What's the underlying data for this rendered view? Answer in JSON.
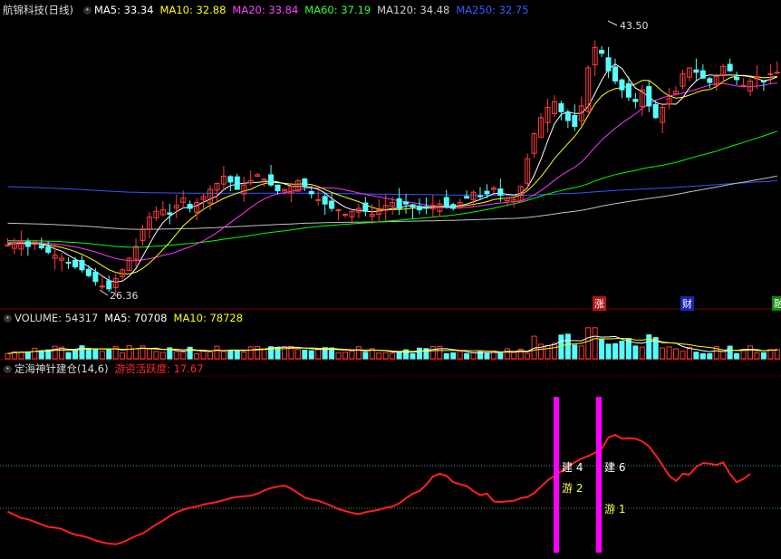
{
  "main_header": {
    "title": "航锦科技(日线)",
    "ma5": "MA5: 33.34",
    "ma10": "MA10: 32.88",
    "ma20": "MA20: 33.84",
    "ma60": "MA60: 37.19",
    "ma120": "MA120: 34.48",
    "ma250": "MA250: 32.75"
  },
  "volume_header": {
    "title": "VOLUME: 54317",
    "ma5": "MA5: 70708",
    "ma10": "MA10: 78728"
  },
  "indicator_header": {
    "title": "定海神针建仓(14,6)",
    "value": "游资活跃度: 17.67"
  },
  "annotations": {
    "high": "43.50",
    "low": "26.36",
    "tag1": "涨",
    "tag2": "财",
    "tag3": "融",
    "sig_jian4": "建 4",
    "sig_you2": "游 2",
    "sig_jian6": "建 6",
    "sig_you1": "游 1"
  },
  "colors": {
    "up": "#ff3c3c",
    "down": "#54ffff",
    "ma5": "#ffffff",
    "ma10": "#ffff00",
    "ma20": "#ff33ff",
    "ma60": "#00ff00",
    "ma120": "#c0c0c0",
    "ma250": "#3355ff",
    "indicator": "#ff2020",
    "signal_bar": "#ff00ff"
  },
  "chart_data": {
    "type": "candlestick",
    "price_range": [
      25.5,
      45
    ],
    "high": 43.5,
    "low": 26.36,
    "closes": [
      29.5,
      29.6,
      29.8,
      29.4,
      29.7,
      29.3,
      29.0,
      28.8,
      28.6,
      28.3,
      28.0,
      27.8,
      27.4,
      27.0,
      26.7,
      26.5,
      27.2,
      27.8,
      28.6,
      29.4,
      30.6,
      31.4,
      31.8,
      31.9,
      31.6,
      32.2,
      32.7,
      32.0,
      32.4,
      32.8,
      33.3,
      33.7,
      34.2,
      33.8,
      33.3,
      33.6,
      33.9,
      34.3,
      34.0,
      33.6,
      33.2,
      33.3,
      33.5,
      33.9,
      33.5,
      33.0,
      32.6,
      32.3,
      32.0,
      31.9,
      31.6,
      31.8,
      32.0,
      31.8,
      31.6,
      31.9,
      32.2,
      32.4,
      32.0,
      32.3,
      32.1,
      31.9,
      32.0,
      32.2,
      32.3,
      32.1,
      32.0,
      32.4,
      32.7,
      33.1,
      32.8,
      33.0,
      33.4,
      32.9,
      32.7,
      32.6,
      33.5,
      35.4,
      37.1,
      38.2,
      38.9,
      39.3,
      38.6,
      38.0,
      37.6,
      39.0,
      41.6,
      43.0,
      42.6,
      41.4,
      40.7,
      40.1,
      39.6,
      39.3,
      40.1,
      39.0,
      38.2,
      38.9,
      39.5,
      40.0,
      41.2,
      41.6,
      41.3,
      40.9,
      40.6,
      41.0,
      41.7,
      41.4,
      40.8,
      40.4,
      40.7,
      41.0,
      40.7,
      41.2,
      41.3
    ],
    "volume_ma5": 70708,
    "volume_ma10": 78728,
    "indicator": [
      33,
      32.5,
      32,
      31.8,
      31.4,
      31,
      30.6,
      30.5,
      30.3,
      29.8,
      29.4,
      29.2,
      28.9,
      28.5,
      28.2,
      28,
      27.9,
      28.2,
      28.7,
      29.2,
      29.6,
      30.3,
      31,
      31.6,
      32.3,
      32.9,
      33.3,
      33.6,
      33.8,
      34.1,
      34.3,
      34.5,
      34.8,
      35.1,
      35.3,
      35.4,
      35.5,
      35.8,
      36.3,
      36.7,
      36.9,
      37.1,
      36.6,
      35.9,
      35.2,
      34.9,
      34.7,
      34.3,
      33.9,
      33.4,
      33.1,
      32.8,
      32.6,
      32.9,
      33.1,
      33.3,
      33.6,
      33.8,
      34.3,
      35.1,
      35.8,
      36.2,
      37.2,
      38.5,
      38.9,
      38.6,
      37.6,
      37.3,
      37.0,
      36.2,
      35.6,
      35.8,
      34.6,
      34.5,
      34.6,
      34.7,
      35.1,
      35.3,
      35.9,
      36.9,
      37.9,
      38.6,
      39.3,
      40.1,
      40.7,
      41.3,
      41.7,
      42.2,
      42.8,
      44.6,
      45.0,
      44.4,
      44.5,
      44.4,
      44.0,
      43.2,
      41.8,
      40.3,
      38.6,
      37.8,
      38.9,
      38.8,
      40.0,
      40.6,
      40.5,
      40.3,
      40.7,
      38.9,
      37.6,
      38.1,
      38.9
    ]
  }
}
